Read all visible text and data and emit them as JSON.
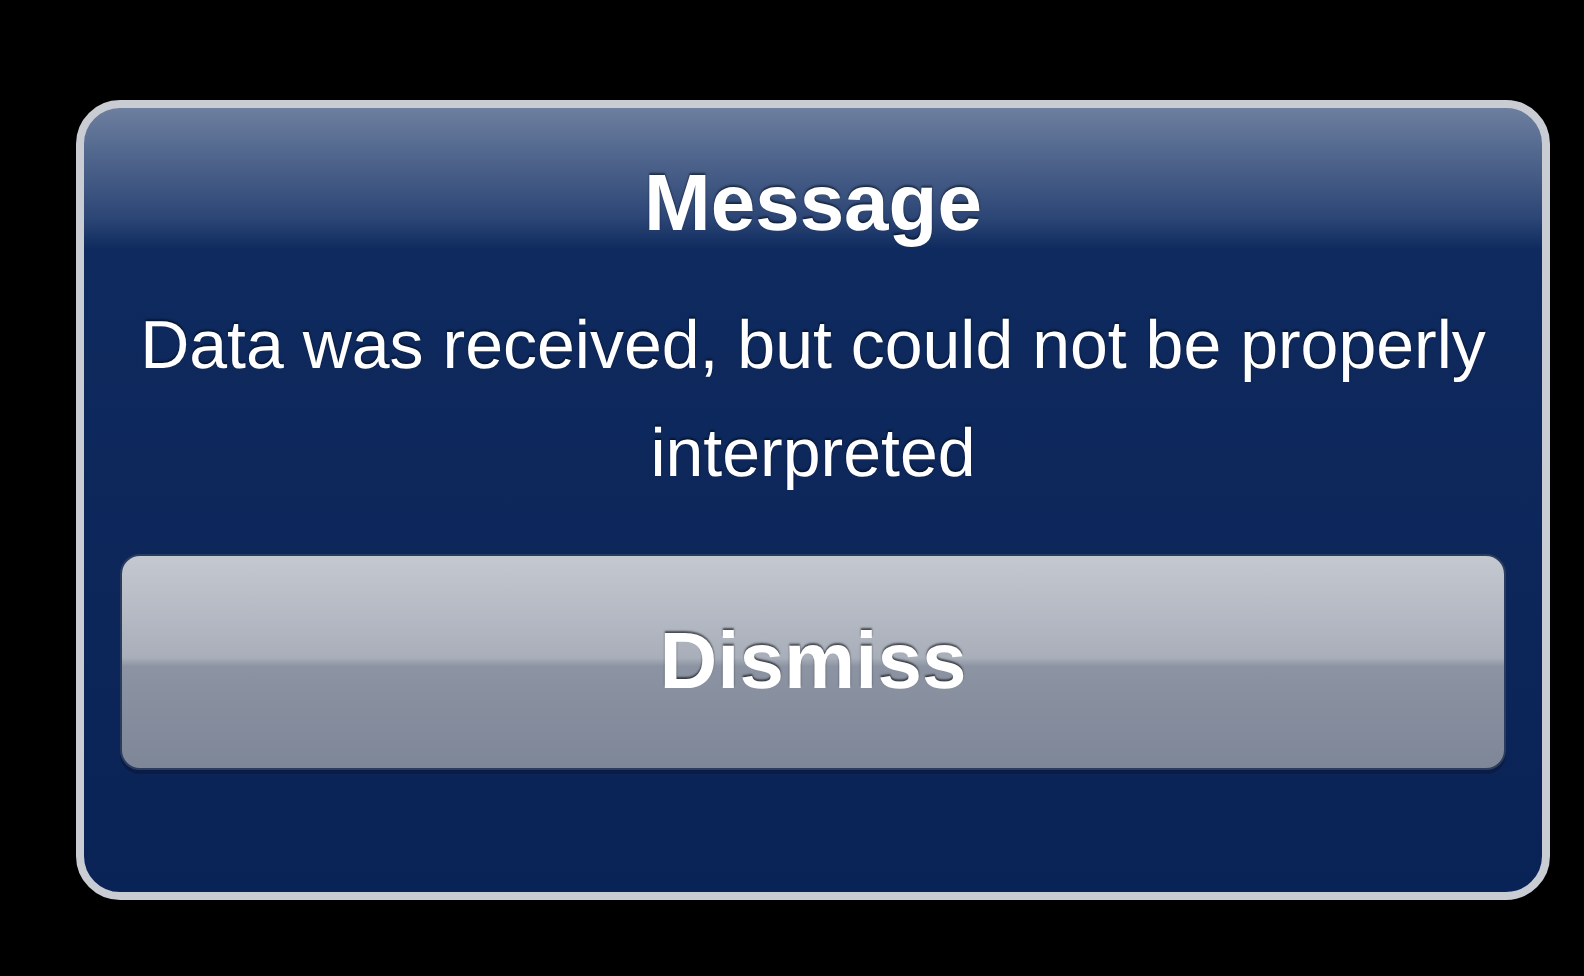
{
  "alert": {
    "title": "Message",
    "message": "Data was received, but could not be properly interpreted",
    "buttons": [
      {
        "label": "Dismiss"
      }
    ]
  }
}
